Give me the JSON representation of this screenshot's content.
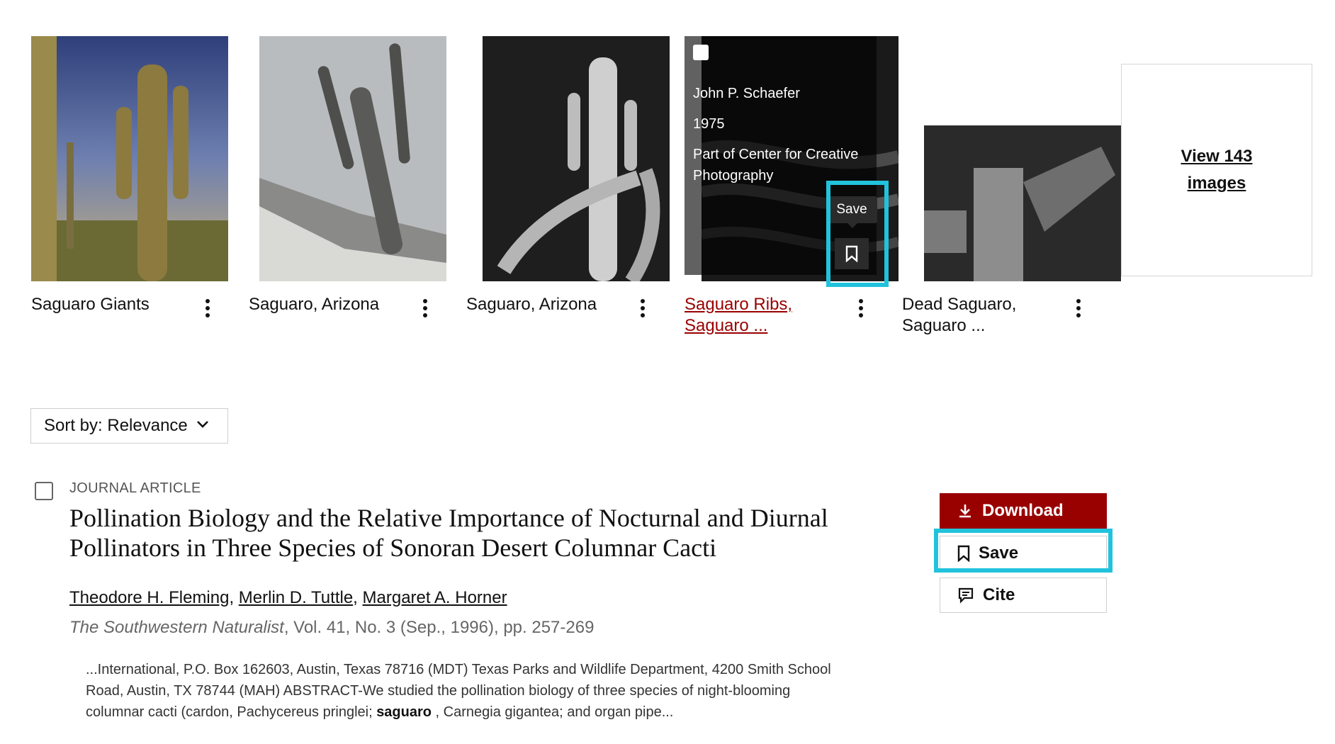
{
  "image_cards": [
    {
      "title": "Saguaro Giants",
      "linked": false
    },
    {
      "title": "Saguaro, Arizona",
      "linked": false
    },
    {
      "title": "Saguaro, Arizona",
      "linked": false
    },
    {
      "title": "Saguaro Ribs, Saguaro ...",
      "linked": true
    },
    {
      "title": "Dead Saguaro, Saguaro ...",
      "linked": false
    }
  ],
  "hover_overlay": {
    "creator": "John P. Schaefer",
    "year": "1975",
    "collection": "Part of Center for Creative Photography",
    "tooltip": "Save"
  },
  "view_more": {
    "label": "View 143 images"
  },
  "sort": {
    "label": "Sort by: Relevance"
  },
  "result": {
    "type": "JOURNAL ARTICLE",
    "title": "Pollination Biology and the Relative Importance of Nocturnal and Diurnal Pollinators in Three Species of Sonoran Desert Columnar Cacti",
    "authors": [
      "Theodore H. Fleming",
      "Merlin D. Tuttle",
      "Margaret A. Horner"
    ],
    "journal": "The Southwestern Naturalist",
    "source_rest": ", Vol. 41, No. 3 (Sep., 1996), pp. 257-269",
    "snippet_before": "...International, P.O. Box 162603, Austin, Texas 78716 (MDT) Texas Parks and Wildlife Department, 4200 Smith School Road, Austin, TX 78744 (MAH) ABSTRACT-We studied the pollination biology of three species of night-blooming columnar cacti (cardon, Pachycereus pringlei; ",
    "snippet_highlight": "saguaro",
    "snippet_after": " , Carnegia gigantea; and organ pipe..."
  },
  "actions": {
    "download": "Download",
    "save": "Save",
    "cite": "Cite"
  },
  "colors": {
    "accent_red": "#990000",
    "highlight_cyan": "#21c3dc"
  }
}
